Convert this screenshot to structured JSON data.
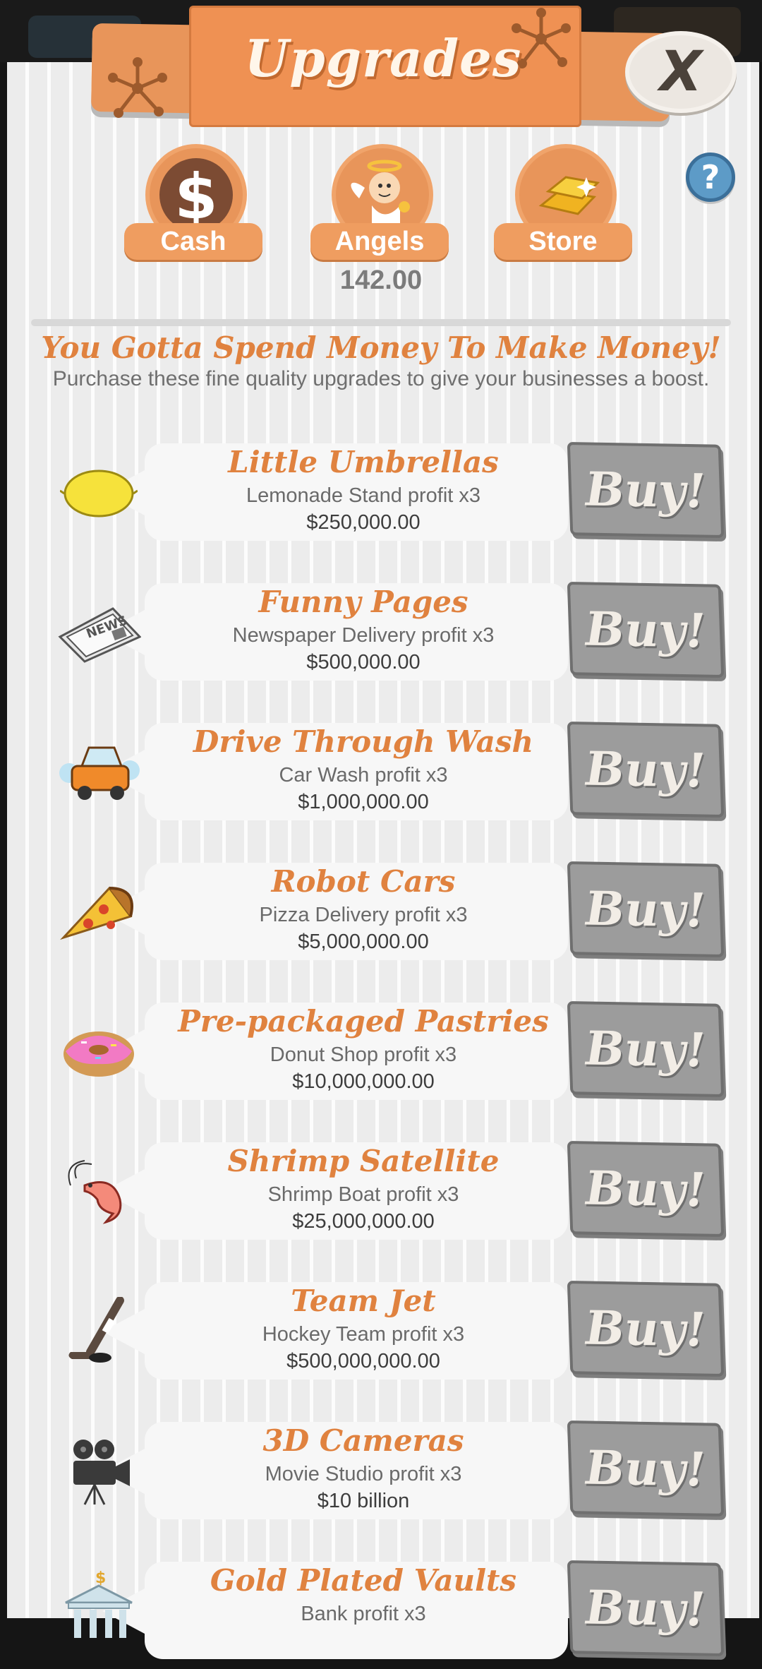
{
  "header": {
    "title": "Upgrades",
    "close_label": "X",
    "help_label": "?"
  },
  "tabs": [
    {
      "label": "Cash",
      "icon": "dollar-coin-icon"
    },
    {
      "label": "Angels",
      "icon": "angel-icon"
    },
    {
      "label": "Store",
      "icon": "gold-bars-icon"
    }
  ],
  "angels_count": "142.00",
  "intro": {
    "headline": "You Gotta Spend Money To Make Money!",
    "subline": "Purchase these fine quality upgrades to give your businesses a boost."
  },
  "upgrades": [
    {
      "title": "Little Umbrellas",
      "desc": "Lemonade Stand profit x3",
      "price": "$250,000.00",
      "buy": "Buy!",
      "icon": "lemon-icon"
    },
    {
      "title": "Funny Pages",
      "desc": "Newspaper Delivery profit x3",
      "price": "$500,000.00",
      "buy": "Buy!",
      "icon": "newspaper-icon"
    },
    {
      "title": "Drive Through Wash",
      "desc": "Car Wash profit x3",
      "price": "$1,000,000.00",
      "buy": "Buy!",
      "icon": "car-wash-icon"
    },
    {
      "title": "Robot Cars",
      "desc": "Pizza Delivery profit x3",
      "price": "$5,000,000.00",
      "buy": "Buy!",
      "icon": "pizza-slice-icon"
    },
    {
      "title": "Pre-packaged Pastries",
      "desc": "Donut Shop profit x3",
      "price": "$10,000,000.00",
      "buy": "Buy!",
      "icon": "donut-icon"
    },
    {
      "title": "Shrimp Satellite",
      "desc": "Shrimp Boat profit x3",
      "price": "$25,000,000.00",
      "buy": "Buy!",
      "icon": "shrimp-icon"
    },
    {
      "title": "Team Jet",
      "desc": "Hockey Team profit x3",
      "price": "$500,000,000.00",
      "buy": "Buy!",
      "icon": "hockey-stick-icon"
    },
    {
      "title": "3D Cameras",
      "desc": "Movie Studio profit x3",
      "price": "$10 billion",
      "buy": "Buy!",
      "icon": "movie-camera-icon"
    },
    {
      "title": "Gold Plated Vaults",
      "desc": "Bank profit x3",
      "price": "",
      "buy": "Buy!",
      "icon": "bank-icon"
    }
  ]
}
